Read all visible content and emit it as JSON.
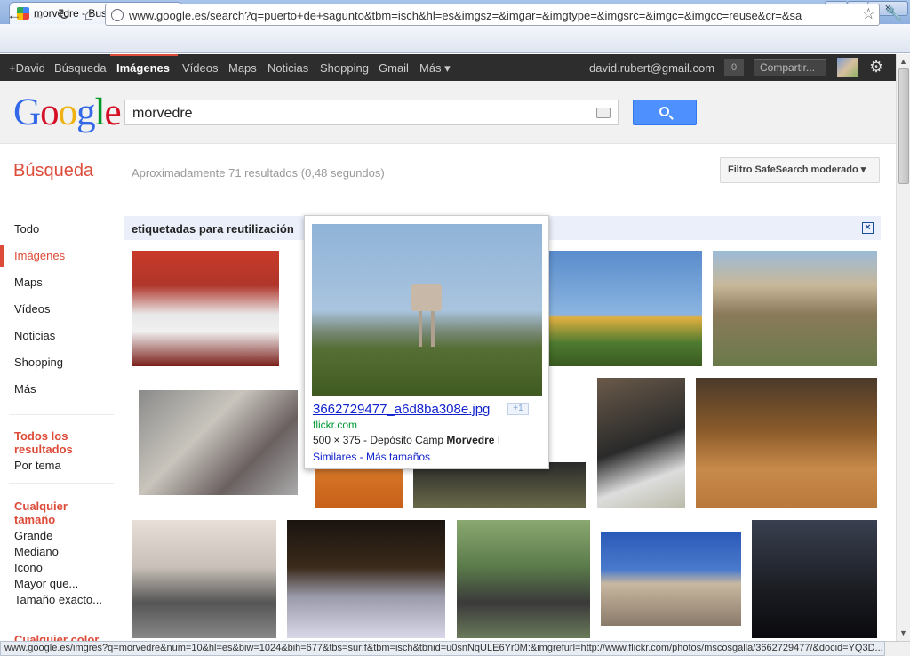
{
  "browser": {
    "tab_title": "morvedre - Buscar con Google",
    "tab_close": "×",
    "new_tab": "+",
    "min": "—",
    "max": "▫",
    "close": "×",
    "url": "www.google.es/search?q=puerto+de+sagunto&tbm=isch&hl=es&imgsz=&imgar=&imgtype=&imgsrc=&imgc=&imgcc=reuse&cr=&sa",
    "status_url": "www.google.es/imgres?q=morvedre&num=10&hl=es&biw=1024&bih=677&tbs=sur:f&tbm=isch&tbnid=u0snNqULE6Yr0M:&imgrefurl=http://www.flickr.com/photos/mscosgalla/3662729477/&docid=YQ3D..."
  },
  "gbar": {
    "items": [
      "+David",
      "Búsqueda",
      "Imágenes",
      "Vídeos",
      "Maps",
      "Noticias",
      "Shopping",
      "Gmail",
      "Más ▾"
    ],
    "email": "david.rubert@gmail.com",
    "notif_count": "0",
    "share": "Compartir..."
  },
  "search": {
    "logo": [
      "G",
      "o",
      "o",
      "g",
      "l",
      "e"
    ],
    "query": "morvedre",
    "section": "Búsqueda",
    "stats": "Aproximadamente 71 resultados (0,48 segundos)",
    "safesearch": "Filtro SafeSearch moderado ▾"
  },
  "leftnav": {
    "types": [
      "Todo",
      "Imágenes",
      "Maps",
      "Vídeos",
      "Noticias",
      "Shopping",
      "Más"
    ],
    "results_head": "Todos los resultados",
    "results_items": [
      "Por tema"
    ],
    "size_head": "Cualquier tamaño",
    "size_items": [
      "Grande",
      "Mediano",
      "Icono",
      "Mayor que...",
      "Tamaño exacto..."
    ],
    "color_head": "Cualquier color"
  },
  "main": {
    "tag_label": "etiquetadas para reutilización",
    "close": "×"
  },
  "popup": {
    "filename": "3662729477_a6d8ba308e.jpg",
    "plus": "+1",
    "source": "flickr.com",
    "dims": "500 × 375 - Depósito Camp ",
    "dims_bold": "Morvedre",
    "dims_tail": " I",
    "similar": "Similares",
    "sep": " - ",
    "more_sizes": "Más tamaños"
  },
  "colors": {
    "red": "#dd4b39",
    "link": "#1122cc",
    "green": "#009933",
    "blue_button": "#4d90fe"
  }
}
